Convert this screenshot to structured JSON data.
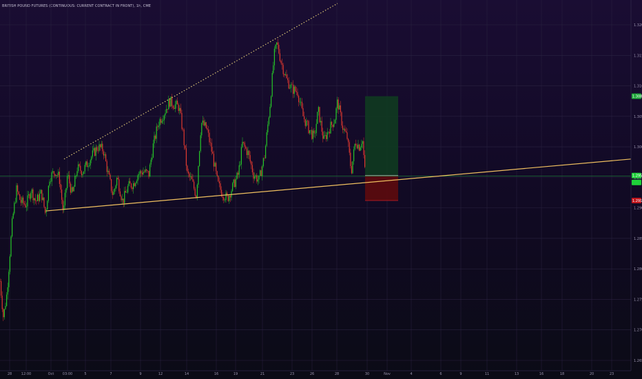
{
  "title": "BRITISH POUND FUTURES (CONTINUOUS: CURRENT CONTRACT IN FRONT), 1h, CME",
  "colors": {
    "up": "#26c828",
    "down": "#e0392f",
    "grid": "#2a2240",
    "trendline_upper": "#e8d27a",
    "trendline_lower": "#f0c060",
    "current_price_line": "#1f8a3a",
    "target_zone": "#0f3a20",
    "stop_zone": "#5a0b0f",
    "target_tag": "#1fa83a",
    "stop_tag": "#c0151c",
    "current_tag": "#1fd13a"
  },
  "chart_data": {
    "type": "candlestick",
    "title": "BRITISH POUND FUTURES (CONTINUOUS: CURRENT CONTRACT IN FRONT), 1h, CME",
    "xlabel": "",
    "ylabel": "",
    "ylim": [
      1.265,
      1.3235
    ],
    "grid": true,
    "y_ticks": [
      "1.3200",
      "1.3150",
      "1.3100",
      "1.3050",
      "1.3000",
      "1.2950",
      "1.2900",
      "1.2850",
      "1.2800",
      "1.2750",
      "1.2700",
      "1.2650"
    ],
    "x_ticks": [
      "28",
      "12:00",
      "Oct",
      "03:00",
      "5",
      "7",
      "9",
      "12",
      "14",
      "16",
      "19",
      "21",
      "23",
      "26",
      "28",
      "30",
      "Nov",
      "4",
      "6",
      "9",
      "11",
      "13",
      "16",
      "18",
      "20",
      "23"
    ],
    "price_path": [
      [
        0,
        1.278
      ],
      [
        5,
        1.272
      ],
      [
        10,
        1.276
      ],
      [
        18,
        1.288
      ],
      [
        24,
        1.293
      ],
      [
        30,
        1.291
      ],
      [
        38,
        1.2905
      ],
      [
        45,
        1.293
      ],
      [
        52,
        1.291
      ],
      [
        60,
        1.2925
      ],
      [
        66,
        1.289
      ],
      [
        72,
        1.295
      ],
      [
        80,
        1.296
      ],
      [
        86,
        1.295
      ],
      [
        92,
        1.289
      ],
      [
        98,
        1.2955
      ],
      [
        105,
        1.292
      ],
      [
        112,
        1.2965
      ],
      [
        120,
        1.296
      ],
      [
        128,
        1.2975
      ],
      [
        136,
        1.299
      ],
      [
        142,
        1.3
      ],
      [
        150,
        1.2995
      ],
      [
        157,
        1.2955
      ],
      [
        164,
        1.292
      ],
      [
        170,
        1.295
      ],
      [
        178,
        1.291
      ],
      [
        186,
        1.2935
      ],
      [
        194,
        1.294
      ],
      [
        200,
        1.2955
      ],
      [
        208,
        1.296
      ],
      [
        216,
        1.2955
      ],
      [
        222,
        1.3
      ],
      [
        230,
        1.304
      ],
      [
        238,
        1.3055
      ],
      [
        246,
        1.3075
      ],
      [
        252,
        1.307
      ],
      [
        260,
        1.3065
      ],
      [
        266,
        1.302
      ],
      [
        272,
        1.2955
      ],
      [
        278,
        1.2945
      ],
      [
        285,
        1.292
      ],
      [
        292,
        1.304
      ],
      [
        300,
        1.303
      ],
      [
        308,
        1.299
      ],
      [
        316,
        1.294
      ],
      [
        322,
        1.2925
      ],
      [
        330,
        1.2915
      ],
      [
        338,
        1.2935
      ],
      [
        346,
        1.2955
      ],
      [
        352,
        1.3005
      ],
      [
        360,
        1.299
      ],
      [
        368,
        1.2955
      ],
      [
        376,
        1.2945
      ],
      [
        384,
        1.2985
      ],
      [
        392,
        1.307
      ],
      [
        398,
        1.315
      ],
      [
        402,
        1.317
      ],
      [
        408,
        1.314
      ],
      [
        416,
        1.311
      ],
      [
        424,
        1.3095
      ],
      [
        432,
        1.309
      ],
      [
        440,
        1.305
      ],
      [
        448,
        1.303
      ],
      [
        456,
        1.3015
      ],
      [
        462,
        1.306
      ],
      [
        470,
        1.301
      ],
      [
        478,
        1.303
      ],
      [
        486,
        1.3045
      ],
      [
        490,
        1.3075
      ],
      [
        498,
        1.303
      ],
      [
        504,
        1.3015
      ],
      [
        510,
        1.296
      ],
      [
        516,
        1.301
      ],
      [
        522,
        1.3
      ],
      [
        526,
        1.3015
      ],
      [
        530,
        1.2955
      ]
    ],
    "trendlines": [
      {
        "name": "",
        "style": "dotted",
        "from": [
          93,
          1.298
        ],
        "to": [
          490,
          1.3235
        ]
      },
      {
        "name": "",
        "style": "solid",
        "from": [
          67,
          1.2895
        ],
        "to": [
          916,
          1.298
        ]
      }
    ],
    "position": {
      "type": "long",
      "entry": 1.2953,
      "target": 1.3083,
      "stop": 1.2912,
      "x_start": 530,
      "x_end": 578
    },
    "price_tags": [
      {
        "label": "1.3083",
        "kind": "target"
      },
      {
        "label": "1.2953",
        "kind": "current"
      },
      {
        "label": "",
        "kind": "current"
      },
      {
        "label": "1.2912",
        "kind": "stop"
      }
    ]
  }
}
